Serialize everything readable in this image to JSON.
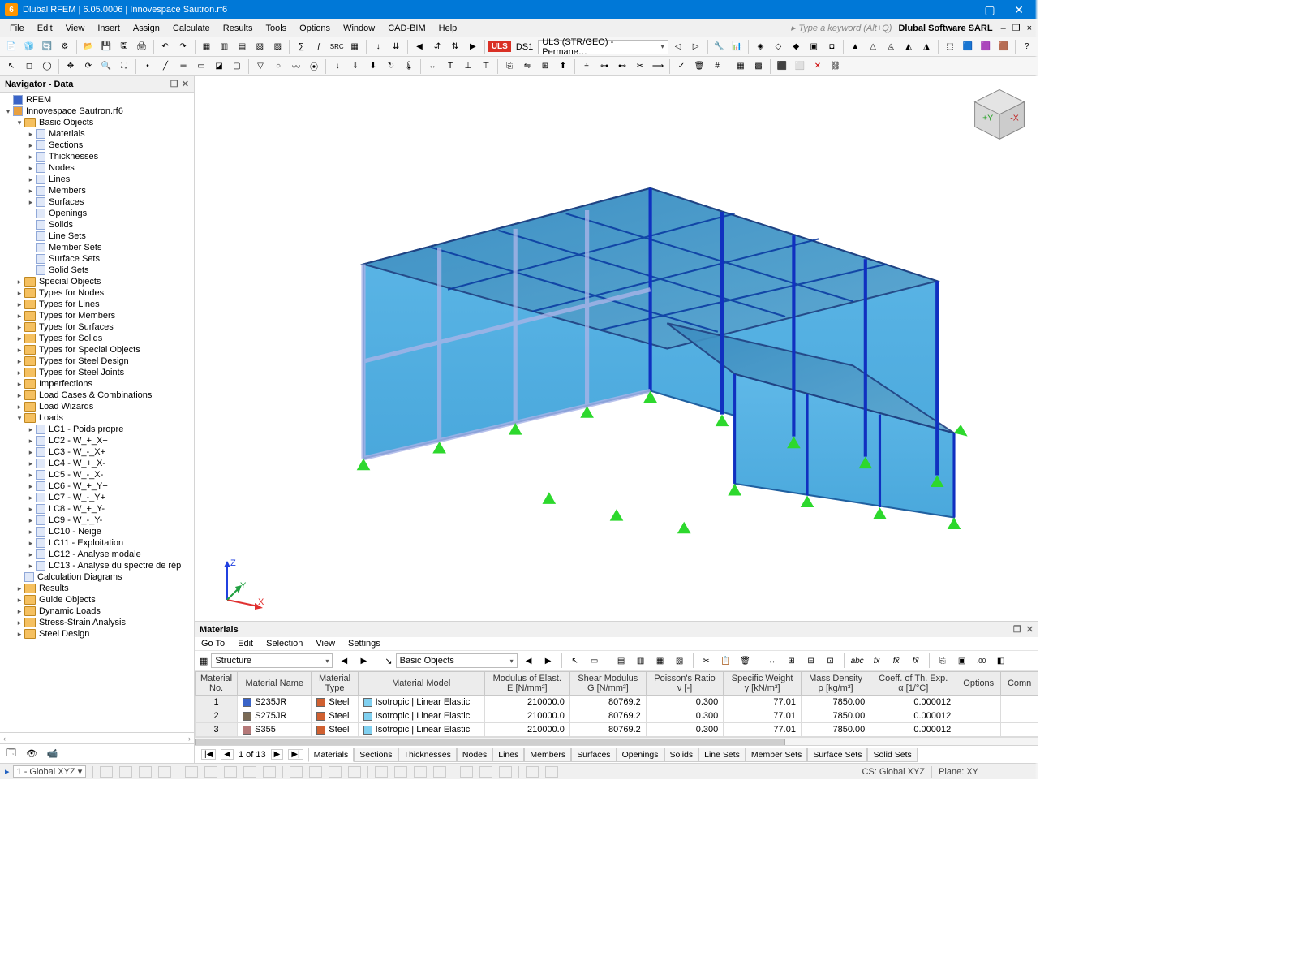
{
  "title": "Dlubal RFEM | 6.05.0006 | Innovespace Sautron.rf6",
  "vendor": "Dlubal Software SARL",
  "menubar": [
    "File",
    "Edit",
    "View",
    "Insert",
    "Assign",
    "Calculate",
    "Results",
    "Tools",
    "Options",
    "Window",
    "CAD-BIM",
    "Help"
  ],
  "menubar_search_placeholder": "Type a keyword (Alt+Q)",
  "toolbar2": {
    "uls_badge": "ULS",
    "ds_label": "DS1",
    "combo_value": "ULS (STR/GEO) - Permane…"
  },
  "navigator": {
    "title": "Navigator - Data",
    "root": "RFEM",
    "file": "Innovespace Sautron.rf6",
    "basic_objects_label": "Basic Objects",
    "basic_objects": [
      "Materials",
      "Sections",
      "Thicknesses",
      "Nodes",
      "Lines",
      "Members",
      "Surfaces",
      "Openings",
      "Solids",
      "Line Sets",
      "Member Sets",
      "Surface Sets",
      "Solid Sets"
    ],
    "folders_mid": [
      "Special Objects",
      "Types for Nodes",
      "Types for Lines",
      "Types for Members",
      "Types for Surfaces",
      "Types for Solids",
      "Types for Special Objects",
      "Types for Steel Design",
      "Types for Steel Joints",
      "Imperfections",
      "Load Cases & Combinations",
      "Load Wizards"
    ],
    "loads_label": "Loads",
    "loads": [
      "LC1 - Poids propre",
      "LC2 - W_+_X+",
      "LC3 - W_-_X+",
      "LC4 - W_+_X-",
      "LC5 - W_-_X-",
      "LC6 - W_+_Y+",
      "LC7 - W_-_Y+",
      "LC8 - W_+_Y-",
      "LC9 - W_-_Y-",
      "LC10 - Neige",
      "LC11 - Exploitation",
      "LC12 - Analyse modale",
      "LC13 - Analyse du spectre de rép"
    ],
    "calc_diag": "Calculation Diagrams",
    "folders_end": [
      "Results",
      "Guide Objects",
      "Dynamic Loads",
      "Stress-Strain Analysis",
      "Steel Design"
    ]
  },
  "materials_panel": {
    "title": "Materials",
    "menu": [
      "Go To",
      "Edit",
      "Selection",
      "View",
      "Settings"
    ],
    "breadcrumb1": "Structure",
    "breadcrumb2": "Basic Objects",
    "headers": {
      "no": "Material\nNo.",
      "name": "Material Name",
      "type": "Material\nType",
      "model": "Material Model",
      "e": "Modulus of Elast.\nE [N/mm²]",
      "g": "Shear Modulus\nG [N/mm²]",
      "v": "Poisson's Ratio\nν [-]",
      "sw": "Specific Weight\nγ [kN/m³]",
      "md": "Mass Density\nρ [kg/m³]",
      "cte": "Coeff. of Th. Exp.\nα [1/°C]",
      "opt": "Options",
      "comm": "Comn"
    },
    "rows": [
      {
        "no": 1,
        "name": "S235JR",
        "sw": "#3a64c8",
        "type": "Steel",
        "model": "Isotropic | Linear Elastic",
        "e": "210000.0",
        "g": "80769.2",
        "v": "0.300",
        "gw": "77.01",
        "md": "7850.00",
        "cte": "0.000012"
      },
      {
        "no": 2,
        "name": "S275JR",
        "sw": "#7a6a56",
        "type": "Steel",
        "model": "Isotropic | Linear Elastic",
        "e": "210000.0",
        "g": "80769.2",
        "v": "0.300",
        "gw": "77.01",
        "md": "7850.00",
        "cte": "0.000012"
      },
      {
        "no": 3,
        "name": "S355",
        "sw": "#b47878",
        "type": "Steel",
        "model": "Isotropic | Linear Elastic",
        "e": "210000.0",
        "g": "80769.2",
        "v": "0.300",
        "gw": "77.01",
        "md": "7850.00",
        "cte": "0.000012"
      }
    ],
    "pager": "1 of 13",
    "tabs": [
      "Materials",
      "Sections",
      "Thicknesses",
      "Nodes",
      "Lines",
      "Members",
      "Surfaces",
      "Openings",
      "Solids",
      "Line Sets",
      "Member Sets",
      "Surface Sets",
      "Solid Sets"
    ]
  },
  "statusbar": {
    "cs_label": "1 - Global XYZ",
    "cs_info": "CS: Global XYZ",
    "plane": "Plane: XY"
  }
}
